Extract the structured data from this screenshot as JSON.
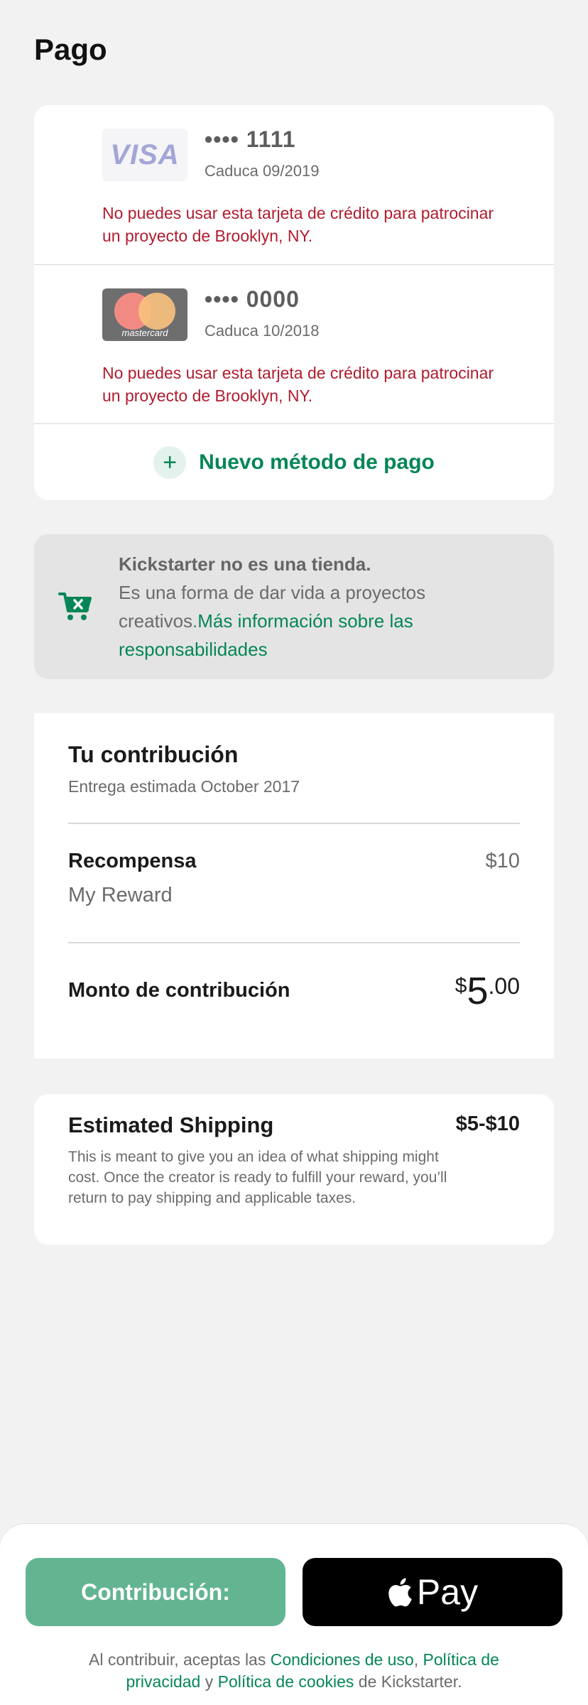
{
  "page": {
    "title": "Pago"
  },
  "cards": [
    {
      "brand": "VISA",
      "number": "•••• 1111",
      "expiry": "Caduca 09/2019",
      "error": "No puedes usar esta tarjeta de crédito para patrocinar un proyecto de Brooklyn, NY."
    },
    {
      "brand": "mastercard",
      "number": "•••• 0000",
      "expiry": "Caduca 10/2018",
      "error": "No puedes usar esta tarjeta de crédito para patrocinar un proyecto de Brooklyn, NY."
    }
  ],
  "add_method": {
    "icon": "plus-icon",
    "label": "Nuevo método de pago"
  },
  "notice": {
    "icon": "cart-x-icon",
    "title": "Kickstarter no es una tienda.",
    "body": "Es una forma de dar vida a proyectos creativos.",
    "link": "Más información sobre las responsabilidades"
  },
  "contribution": {
    "title": "Tu contribución",
    "delivery": "Entrega estimada October 2017",
    "reward_label": "Recompensa",
    "reward_price": "$10",
    "reward_name": "My Reward",
    "amount_label": "Monto de contribución",
    "amount_currency": "$",
    "amount_integer": "5",
    "amount_decimal": ".00"
  },
  "shipping": {
    "title": "Estimated Shipping",
    "range": "$5-$10",
    "description": "This is meant to give you an idea of what shipping might cost. Once the creator is ready to fulfill your reward, you’ll return to pay shipping and applicable taxes."
  },
  "footer": {
    "pledge_label": "Contribución:",
    "applepay_label": "Pay",
    "terms_prefix": "Al contribuir, aceptas las ",
    "terms_link1": "Condiciones de uso",
    "terms_sep1": ", ",
    "terms_link2": "Política de privacidad",
    "terms_sep2": " y ",
    "terms_link3": "Política de cookies",
    "terms_suffix": " de Kickstarter."
  },
  "colors": {
    "accent": "#068656",
    "error": "#b01c2e",
    "pledge_button": "#63b592"
  }
}
